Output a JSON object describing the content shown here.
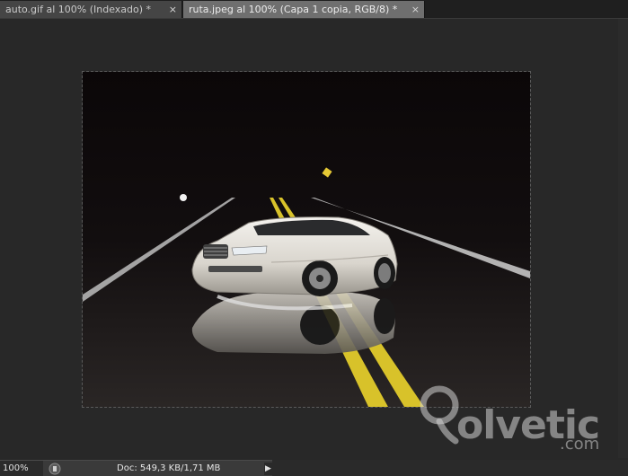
{
  "tabs": [
    {
      "label": "auto.gif al 100% (Indexado) *",
      "close_icon": "×",
      "active": false
    },
    {
      "label": "ruta.jpeg al 100% (Capa 1 copia, RGB/8) *",
      "close_icon": "×",
      "active": true
    }
  ],
  "status": {
    "zoom": "100%",
    "doc_info": "Doc: 549,3 KB/1,71 MB",
    "menu_arrow": "▶"
  },
  "watermark": {
    "logo_text": "olvetic",
    "suffix": ".com"
  },
  "icons": {
    "close": "close-icon",
    "status": "status-info-icon",
    "menu": "triangle-right-icon",
    "logo": "solvetic-bulb-logo"
  }
}
